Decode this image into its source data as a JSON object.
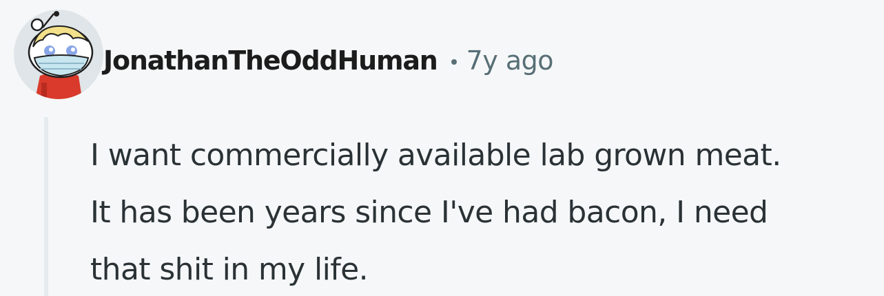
{
  "comment": {
    "author": "JonathanTheOddHuman",
    "age": "7y ago",
    "body_lines": [
      "I want commercially available lab grown meat.",
      "It has been years since I've had bacon, I need",
      "that shit in my life."
    ]
  },
  "avatar": {
    "icon": "snoo-avatar-icon",
    "description_colors": {
      "background": "#dfe5e9",
      "face": "#ffffff",
      "hair": "#f2e08a",
      "mask": "#c8e6f0",
      "shirt": "#d93a2b"
    }
  }
}
